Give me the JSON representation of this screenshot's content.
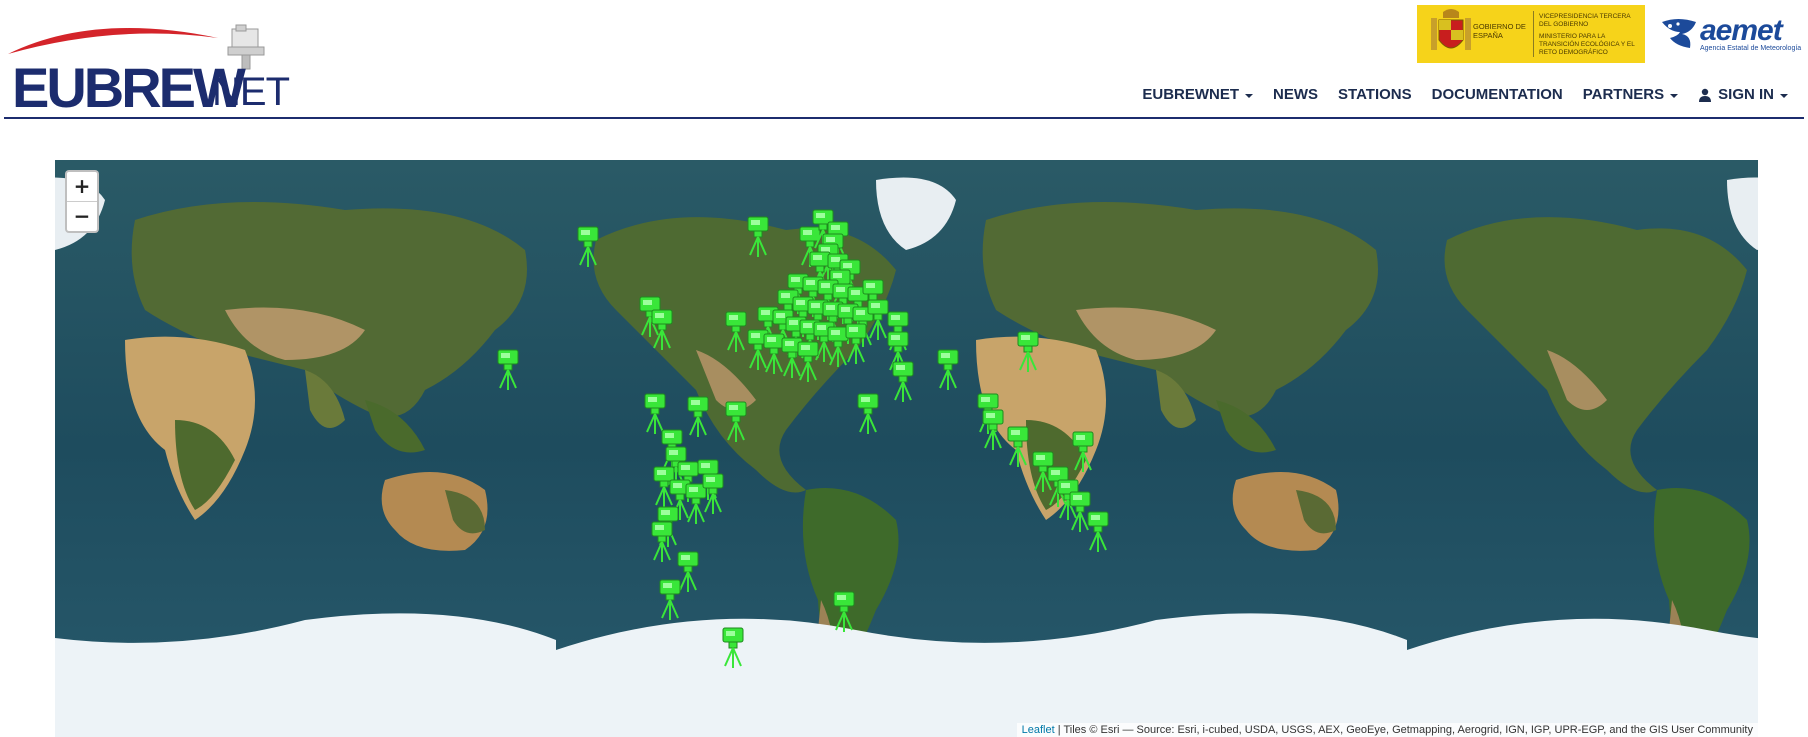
{
  "brand": {
    "logo_main": "EUBREW",
    "logo_sub": "NET",
    "gov_text_1": "Gobierno de España",
    "gov_text_2": "Vicepresidencia tercera del gobierno",
    "gov_text_3": "Ministerio para la transición ecológica y el reto demográfico",
    "aemet_name": "aemet",
    "aemet_sub": "Agencia Estatal de Meteorología"
  },
  "nav": {
    "items": [
      {
        "label": "EUBREWNET",
        "dropdown": true
      },
      {
        "label": "NEWS",
        "dropdown": false
      },
      {
        "label": "STATIONS",
        "dropdown": false
      },
      {
        "label": "DOCUMENTATION",
        "dropdown": false
      },
      {
        "label": "PARTNERS",
        "dropdown": true
      },
      {
        "label": "SIGN IN",
        "dropdown": true,
        "icon": "user-icon"
      }
    ]
  },
  "map": {
    "zoom_in": "+",
    "zoom_out": "−",
    "attribution_link": "Leaflet",
    "attribution_text": " | Tiles © Esri — Source: Esri, i-cubed, USDA, USGS, AEX, GeoEye, Getmapping, Aerogrid, IGN, IGP, UPR-EGP, and the GIS User Community",
    "marker_color": "#39e639",
    "marker_icon": "brewer-station-icon",
    "station_count": 86
  }
}
